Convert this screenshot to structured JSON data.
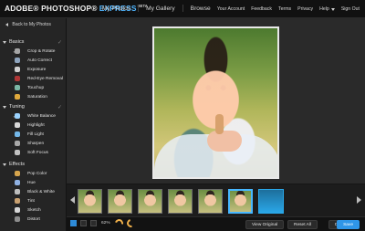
{
  "topbar": {
    "brand_main": "ADOBE® PHOTOSHOP®",
    "brand_sub": "EXPRESS",
    "brand_badge": "BETA",
    "nav": [
      "My Photos",
      "My Gallery",
      "Browse"
    ],
    "account_links": [
      "Your Account",
      "Feedback",
      "Terms",
      "Privacy",
      "Help",
      "Sign Out"
    ]
  },
  "sidebar": {
    "back_link": "Back to My Photos",
    "sections": [
      {
        "title": "Basics",
        "items": [
          {
            "label": "Crop & Rotate",
            "icon": "crop-icon",
            "checked": true
          },
          {
            "label": "Auto Correct",
            "icon": "auto-correct-icon",
            "checked": false
          },
          {
            "label": "Exposure",
            "icon": "exposure-icon",
            "checked": false
          },
          {
            "label": "Red-Eye Removal",
            "icon": "red-eye-icon",
            "checked": false
          },
          {
            "label": "Touchup",
            "icon": "touchup-icon",
            "checked": false
          },
          {
            "label": "Saturation",
            "icon": "saturation-icon",
            "checked": false
          }
        ]
      },
      {
        "title": "Tuning",
        "items": [
          {
            "label": "White Balance",
            "icon": "white-balance-icon",
            "checked": true
          },
          {
            "label": "Highlight",
            "icon": "highlight-icon",
            "checked": false
          },
          {
            "label": "Fill Light",
            "icon": "fill-light-icon",
            "checked": false
          },
          {
            "label": "Sharpen",
            "icon": "sharpen-icon",
            "checked": false
          },
          {
            "label": "Soft Focus",
            "icon": "soft-focus-icon",
            "checked": false
          }
        ]
      },
      {
        "title": "Effects",
        "items": [
          {
            "label": "Pop Color",
            "icon": "pop-color-icon",
            "checked": false
          },
          {
            "label": "Hue",
            "icon": "hue-icon",
            "checked": false
          },
          {
            "label": "Black & White",
            "icon": "black-white-icon",
            "checked": false
          },
          {
            "label": "Tint",
            "icon": "tint-icon",
            "checked": false
          },
          {
            "label": "Sketch",
            "icon": "sketch-icon",
            "checked": false
          },
          {
            "label": "Distort",
            "icon": "distort-icon",
            "checked": false
          }
        ]
      }
    ]
  },
  "main": {
    "photo_alt": "Child photo"
  },
  "filmstrip": {
    "thumb_count": 6,
    "active_index": 5
  },
  "bottombar": {
    "zoom": "62%",
    "view_original": "View Original",
    "reset_all": "Reset All",
    "done": "Done",
    "save": "Save"
  },
  "colors": {
    "accent": "#2f96e8",
    "selection": "#47b7ff"
  }
}
